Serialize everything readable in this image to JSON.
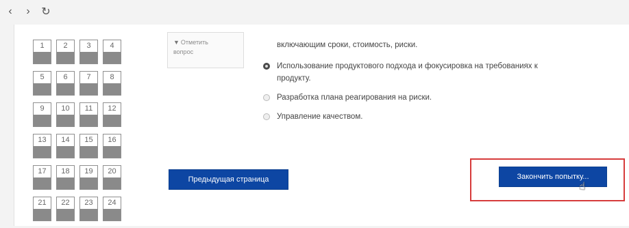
{
  "browser": {
    "back_icon": "chevron-left-icon",
    "forward_icon": "chevron-right-icon",
    "reload_icon": "reload-icon"
  },
  "navigation": {
    "rows": [
      [
        "1",
        "2",
        "3",
        "4"
      ],
      [
        "5",
        "6",
        "7",
        "8"
      ],
      [
        "9",
        "10",
        "11",
        "12"
      ],
      [
        "13",
        "14",
        "15",
        "16"
      ],
      [
        "17",
        "18",
        "19",
        "20"
      ],
      [
        "21",
        "22",
        "23",
        "24"
      ]
    ]
  },
  "flag": {
    "line1": "Отметить",
    "line2": "вопрос"
  },
  "question": {
    "prev_text": "включающим сроки, стоимость, риски.",
    "options": [
      {
        "text": "Использование продуктового подхода и фокусировка на требованиях к продукту.",
        "selected": true
      },
      {
        "text": "Разработка плана реагирования на риски.",
        "selected": false
      },
      {
        "text": "Управление качеством.",
        "selected": false
      }
    ]
  },
  "buttons": {
    "prev": "Предыдущая страница",
    "finish": "Закончить попытку..."
  },
  "colors": {
    "button_bg": "#0d46a3",
    "highlight": "#d63a3a",
    "answered_fill": "#8a8a8a"
  }
}
